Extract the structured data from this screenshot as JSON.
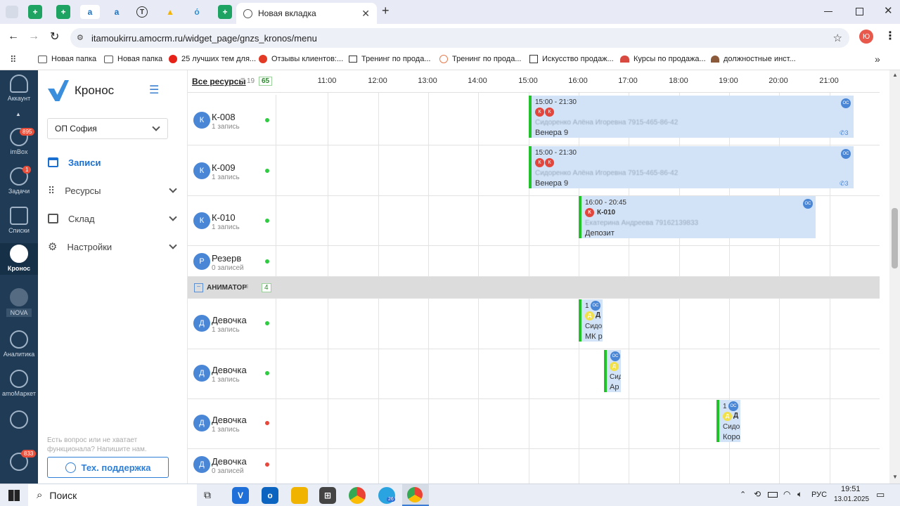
{
  "browser": {
    "tab_title": "Новая вкладка",
    "url": "itamoukirru.amocrm.ru/widget_page/gnzs_kronos/menu",
    "profile_initial": "Ю",
    "bookmarks": [
      "Новая папка",
      "Новая папка",
      "25 лучших тем для...",
      "Отзывы клиентов:...",
      "Тренинг по прода...",
      "Тренинг по прода...",
      "Искусство продаж...",
      "Курсы по продажа...",
      "должностные инст..."
    ]
  },
  "amo_sidebar": {
    "items": [
      {
        "label": "Аккаунт",
        "badge": ""
      },
      {
        "label": "imBox",
        "badge": "895"
      },
      {
        "label": "Задачи",
        "badge": "1"
      },
      {
        "label": "Списки",
        "badge": ""
      },
      {
        "label": "Кронос",
        "badge": ""
      },
      {
        "label": "NOVA",
        "badge": ""
      },
      {
        "label": "Аналитика",
        "badge": ""
      },
      {
        "label": "amoМаркет",
        "badge": ""
      },
      {
        "label": "",
        "badge": ""
      },
      {
        "label": "",
        "badge": "833"
      }
    ]
  },
  "kronos": {
    "logo": "Кронос",
    "branch": "ОП София",
    "menu": {
      "records": "Записи",
      "resources": "Ресурсы",
      "warehouse": "Склад",
      "settings": "Настройки"
    },
    "help_text": "Есть вопрос или не хватает функционала? Напишите нам.",
    "support_button": "Тех. поддержка"
  },
  "schedule": {
    "all_resources_label": "Все ресурсы",
    "filter_count": "19",
    "total_badge": "65",
    "hours": [
      "11:00",
      "12:00",
      "13:00",
      "14:00",
      "15:00",
      "16:00",
      "17:00",
      "18:00",
      "19:00",
      "20:00",
      "21:00"
    ],
    "group": {
      "name": "АНИМАТОР",
      "count": "4"
    },
    "rows": [
      {
        "initial": "К",
        "name": "К-008",
        "count": "1 запись",
        "status_color": "#2ecc40"
      },
      {
        "initial": "К",
        "name": "К-009",
        "count": "1 запись",
        "status_color": "#2ecc40"
      },
      {
        "initial": "К",
        "name": "К-010",
        "count": "1 запись",
        "status_color": "#2ecc40"
      },
      {
        "initial": "Р",
        "name": "Резерв",
        "count": "0 записей",
        "status_color": "#2ecc40"
      },
      {
        "initial": "Д",
        "name": "Девочка",
        "count": "1 запись",
        "status_color": "#2ecc40"
      },
      {
        "initial": "Д",
        "name": "Девочка",
        "count": "1 запись",
        "status_color": "#2ecc40"
      },
      {
        "initial": "Д",
        "name": "Девочка",
        "count": "1 запись",
        "status_color": "#e8473c"
      },
      {
        "initial": "Д",
        "name": "Девочка",
        "count": "0 записей",
        "status_color": "#e8473c"
      }
    ],
    "events": [
      {
        "time": "15:00 - 21:30",
        "client": "Сидоренко Алёна Игоревна",
        "phone": "7915-465-86-42",
        "place": "Венера 9",
        "calls": "3",
        "tag": "ОС"
      },
      {
        "time": "15:00 - 21:30",
        "client": "Сидоренко Алёна Игоревна",
        "phone": "7915-465-86-42",
        "place": "Венера 9",
        "calls": "3",
        "tag": "ОС"
      },
      {
        "time": "16:00 - 20:45",
        "title": "К-010",
        "client": "Екатерина Андреева",
        "phone": "79162139833",
        "place": "Депозит",
        "tag": "ОС"
      },
      {
        "time": "1",
        "title": "Д",
        "client": "Сидор",
        "place": "МК р",
        "tag": "ОС"
      },
      {
        "client": "Сид",
        "place": "Ар",
        "tag": "ОС"
      },
      {
        "time": "1",
        "title": "Д",
        "client": "Сидор",
        "place": "Корол",
        "tag": "ОС"
      }
    ]
  },
  "taskbar": {
    "search": "Поиск",
    "lang": "РУС",
    "time": "19:51",
    "date": "13.01.2025",
    "telegram_badge": "26"
  }
}
